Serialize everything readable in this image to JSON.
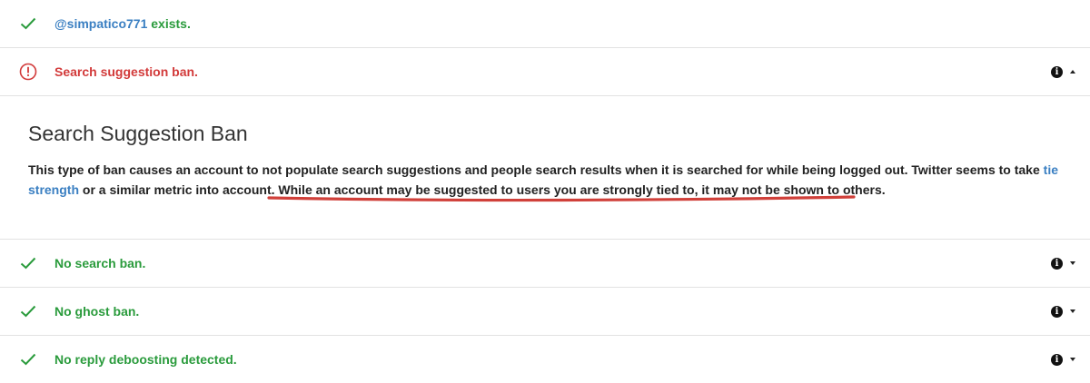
{
  "rows": {
    "exists": {
      "handle": "@simpatico771",
      "suffix": " exists.",
      "icon": "checkmark-icon"
    },
    "suggestion": {
      "label": "Search suggestion ban.",
      "icon": "alert-circle-icon",
      "info_icon": "info-icon",
      "caret_icon": "caret-up-icon"
    },
    "search": {
      "label": "No search ban.",
      "icon": "checkmark-icon",
      "info_icon": "info-icon",
      "caret_icon": "caret-down-icon"
    },
    "ghost": {
      "label": "No ghost ban.",
      "icon": "checkmark-icon",
      "info_icon": "info-icon",
      "caret_icon": "caret-down-icon"
    },
    "reply": {
      "label": "No reply deboosting detected.",
      "icon": "checkmark-icon",
      "info_icon": "info-icon",
      "caret_icon": "caret-down-icon"
    }
  },
  "detail": {
    "title": "Search Suggestion Ban",
    "text_before_link": "This type of ban causes an account to not populate search suggestions and people search results when it is searched for while being logged out. Twitter seems to take ",
    "link_text": "tie strength",
    "text_after_link": " or a similar metric into account. ",
    "highlighted_text": "While an account may be suggested to users you are strongly tied to, it may not be shown to others."
  },
  "colors": {
    "success": "#2a9b3c",
    "error": "#d23a3a",
    "link": "#3a7fc2",
    "annotation_underline": "#d0403a"
  }
}
